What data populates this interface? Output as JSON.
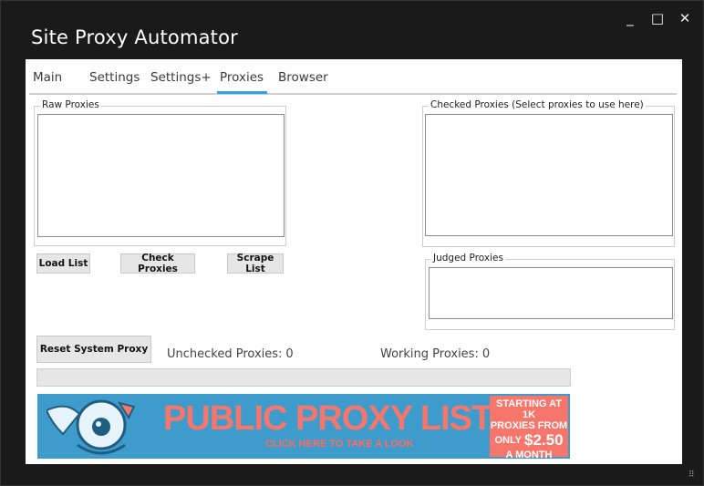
{
  "window": {
    "title": "Site Proxy Automator",
    "controls": {
      "minimize": "_",
      "maximize": "□",
      "close": "✕"
    }
  },
  "tabs": [
    {
      "label": "Main"
    },
    {
      "label": "Settings"
    },
    {
      "label": "Settings+"
    },
    {
      "label": "Proxies",
      "selected": true
    },
    {
      "label": "Browser"
    }
  ],
  "groups": {
    "raw": "Raw Proxies",
    "checked": "Checked Proxies (Select proxies to use here)",
    "judged": "Judged Proxies"
  },
  "buttons": {
    "load_list": "Load List",
    "check_proxies": "Check Proxies",
    "scrape_list": "Scrape List",
    "reset_system_proxy": "Reset System Proxy"
  },
  "stats": {
    "unchecked_label": "Unchecked Proxies:",
    "unchecked_value": "0",
    "working_label": "Working Proxies:",
    "working_value": "0"
  },
  "progress": {
    "value_percent": 0
  },
  "banner": {
    "headline": "PUBLIC PROXY LISTS",
    "cta": "CLICK HERE TO TAKE A LOOK",
    "promo_line1": "STARTING AT 1K",
    "promo_line2": "PROXIES FROM",
    "promo_only": "ONLY",
    "promo_price": "$2.50",
    "promo_line4": "A MONTH"
  },
  "colors": {
    "accent": "#2aa7e0",
    "window_bg": "#1a1a1a",
    "banner_bg": "#3e9ccd",
    "banner_coral": "#f7766c"
  }
}
